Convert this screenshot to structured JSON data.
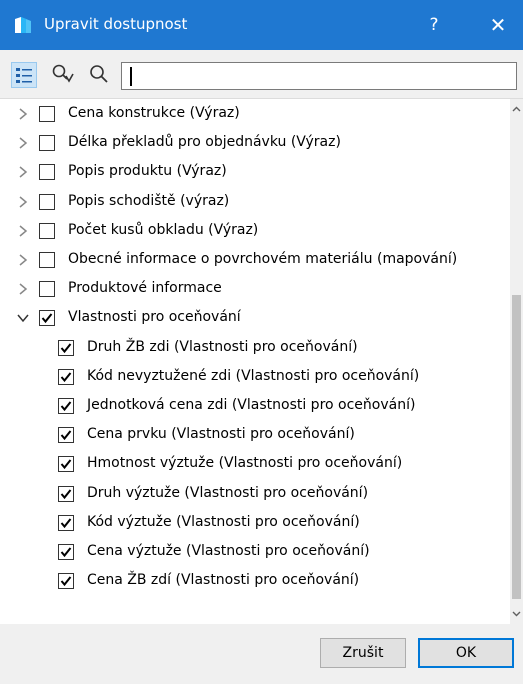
{
  "window": {
    "title": "Upravit dostupnost",
    "help_label": "?",
    "close_label": "✕"
  },
  "toolbar": {
    "search_value": ""
  },
  "tree": {
    "items": [
      {
        "label": "Cena konstrukce (Výraz)",
        "checked": false,
        "expanded": false,
        "level": 0
      },
      {
        "label": "Délka překladů pro objednávku (Výraz)",
        "checked": false,
        "expanded": false,
        "level": 0
      },
      {
        "label": "Popis produktu (Výraz)",
        "checked": false,
        "expanded": false,
        "level": 0
      },
      {
        "label": "Popis schodiště (výraz)",
        "checked": false,
        "expanded": false,
        "level": 0
      },
      {
        "label": "Počet kusů obkladu (Výraz)",
        "checked": false,
        "expanded": false,
        "level": 0
      },
      {
        "label": "Obecné informace o povrchovém materiálu (mapování)",
        "checked": false,
        "expanded": false,
        "level": 0
      },
      {
        "label": "Produktové informace",
        "checked": false,
        "expanded": false,
        "level": 0
      },
      {
        "label": "Vlastnosti pro oceňování",
        "checked": true,
        "expanded": true,
        "level": 0
      },
      {
        "label": "Druh ŽB zdi (Vlastnosti pro oceňování)",
        "checked": true,
        "level": 1
      },
      {
        "label": "Kód nevyztužené zdi (Vlastnosti pro oceňování)",
        "checked": true,
        "level": 1
      },
      {
        "label": "Jednotková cena zdi (Vlastnosti pro oceňování)",
        "checked": true,
        "level": 1
      },
      {
        "label": "Cena prvku (Vlastnosti pro oceňování)",
        "checked": true,
        "level": 1
      },
      {
        "label": "Hmotnost výztuže (Vlastnosti pro oceňování)",
        "checked": true,
        "level": 1
      },
      {
        "label": "Druh výztuže (Vlastnosti pro oceňování)",
        "checked": true,
        "level": 1
      },
      {
        "label": "Kód výztuže (Vlastnosti pro oceňování)",
        "checked": true,
        "level": 1
      },
      {
        "label": "Cena výztuže (Vlastnosti pro oceňování)",
        "checked": true,
        "level": 1
      },
      {
        "label": "Cena ŽB zdí (Vlastnosti pro oceňování)",
        "checked": true,
        "level": 1
      }
    ]
  },
  "footer": {
    "cancel_label": "Zrušit",
    "ok_label": "OK"
  },
  "colors": {
    "titlebar": "#1f78d1",
    "accent": "#0078d7"
  }
}
